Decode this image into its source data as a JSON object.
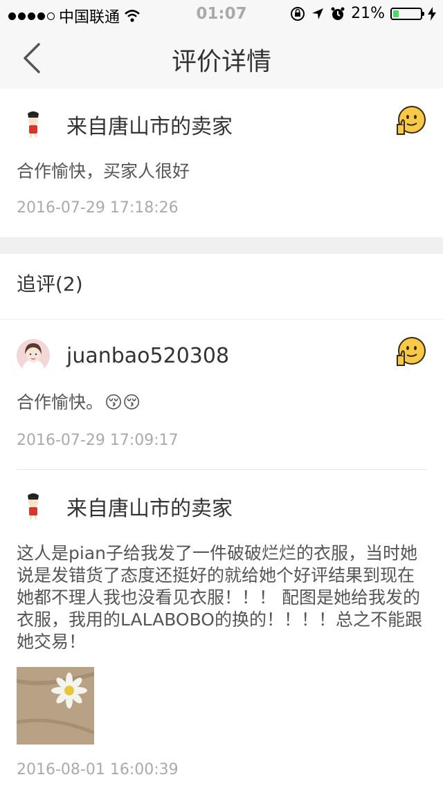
{
  "status_bar": {
    "carrier": "中国联通",
    "time": "01:07",
    "battery": "21%",
    "battery_level": 0.21
  },
  "nav": {
    "title": "评价详情",
    "back_icon": "chevron-left-icon"
  },
  "original_review": {
    "user": "来自唐山市的卖家",
    "content": "合作愉快，买家人很好",
    "time": "2016-07-29 17:18:26",
    "rating_icon": "thumbs-up-emoji-icon"
  },
  "followups": {
    "header": "追评(2)",
    "items": [
      {
        "user": "juanbao520308",
        "content": "合作愉快。",
        "content_emoji": "😚😚",
        "time": "2016-07-29 17:09:17",
        "rating_icon": "thumbs-up-emoji-icon"
      },
      {
        "user": "来自唐山市的卖家",
        "content": "这人是pian子给我发了一件破破烂烂的衣服，当时她说是发错货了态度还挺好的就给她个好评结果到现在她都不理人我也没看见衣服！！！ 配图是她给我发的衣服，我用的LALABOBO的换的！！！！总之不能跟她交易！",
        "time": "2016-08-01 16:00:39",
        "has_photo": true
      }
    ]
  },
  "colors": {
    "background": "#f0f0f0",
    "card": "#ffffff",
    "text": "#333333",
    "muted": "#aaaaaa",
    "emoji_yellow": "#f7c948"
  }
}
